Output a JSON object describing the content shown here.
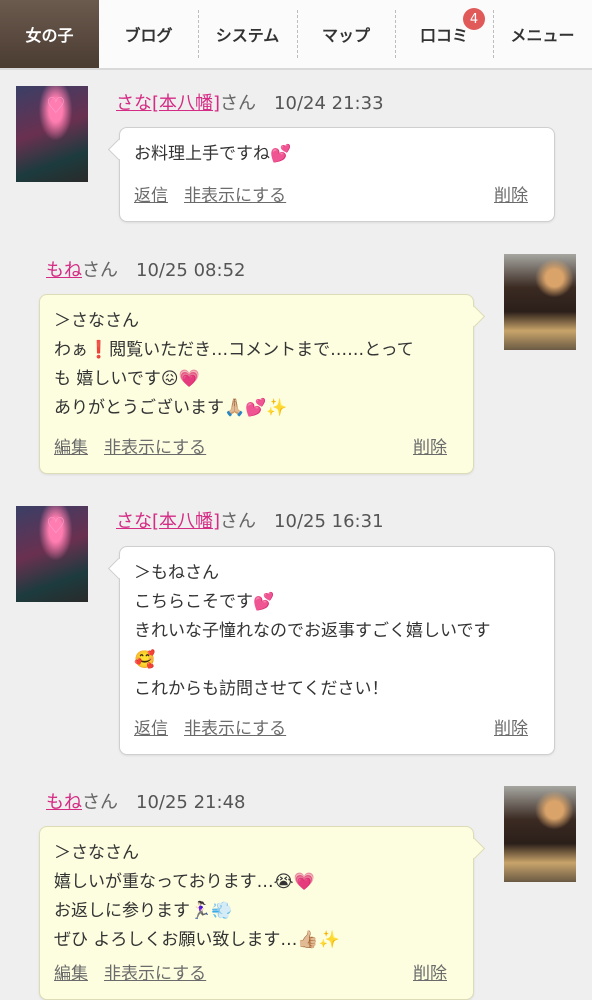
{
  "nav": {
    "tabs": [
      {
        "label": "女の子"
      },
      {
        "label": "ブログ"
      },
      {
        "label": "システム"
      },
      {
        "label": "マップ"
      },
      {
        "label": "口コミ",
        "badge": "4"
      },
      {
        "label": "メニュー"
      }
    ]
  },
  "comments": [
    {
      "user": "さな[本八幡]",
      "suffix": "さん",
      "time": "10/24 21:33",
      "lines": [
        "お料理上手ですね💕"
      ],
      "action1": "返信",
      "action2": "非表示にする",
      "action3": "削除"
    },
    {
      "user": "もね",
      "suffix": "さん",
      "time": "10/25 08:52",
      "lines": [
        "＞さなさん",
        "わぁ❗️閲覧いただき…コメントまで……とって",
        "も 嬉しいです😖💗",
        "ありがとうございます🙏🏼💕✨"
      ],
      "action1": "編集",
      "action2": "非表示にする",
      "action3": "削除"
    },
    {
      "user": "さな[本八幡]",
      "suffix": "さん",
      "time": "10/25 16:31",
      "lines": [
        "＞もねさん",
        "こちらこそです💕",
        "きれいな子憧れなのでお返事すごく嬉しいです",
        "🥰",
        "これからも訪問させてください！"
      ],
      "action1": "返信",
      "action2": "非表示にする",
      "action3": "削除"
    },
    {
      "user": "もね",
      "suffix": "さん",
      "time": "10/25 21:48",
      "lines": [
        "＞さなさん",
        "嬉しいが重なっております…😭💗",
        "お返しに参ります🏃🏻‍♀️💨",
        "ぜひ よろしくお願い致します…👍🏼✨"
      ],
      "action1": "編集",
      "action2": "非表示にする",
      "action3": "削除"
    }
  ]
}
